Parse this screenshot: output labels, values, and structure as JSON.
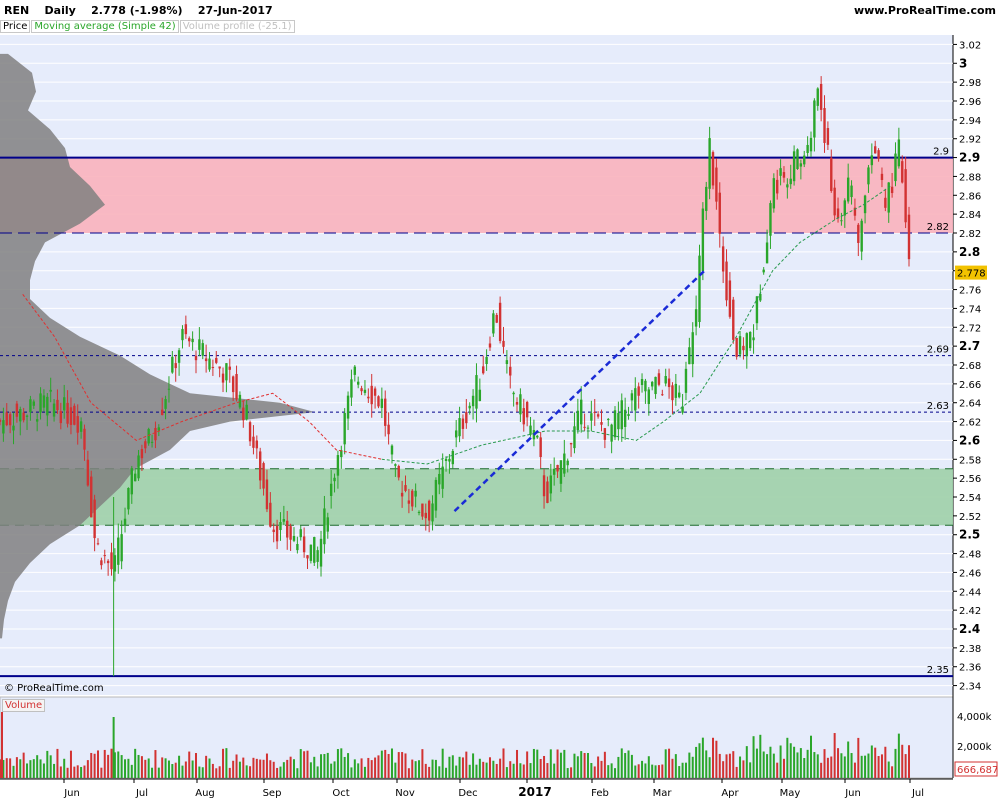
{
  "header": {
    "symbol": "REN",
    "period": "Daily",
    "price_change": "2.778 (-1.98%)",
    "date": "27-Jun-2017",
    "site": "www.ProRealTime.com"
  },
  "legend": {
    "price": "Price",
    "ma": "Moving average (Simple 42)",
    "vol_profile": "Volume profile (-25.1)"
  },
  "copyright": "© ProRealTime.com",
  "volume_label": "Volume",
  "colors": {
    "up": "#2aa62a",
    "down": "#d23232",
    "resistance_zone": "#f9b3bd",
    "support_zone": "#9fd0a8",
    "level_line": "#00008b",
    "trend_line": "#1a2bd6",
    "profile": "#808080",
    "ma_pre": "#e03030",
    "ma_post": "#2a9a50",
    "background": "#e6ecfb",
    "last_price_badge": "#f2c200"
  },
  "chart_data": {
    "type": "line",
    "price_axis": {
      "min": 2.33,
      "max": 3.03,
      "ticks": [
        "3.02",
        "3",
        "2.98",
        "2.96",
        "2.94",
        "2.92",
        "2.9",
        "2.88",
        "2.86",
        "2.84",
        "2.82",
        "2.8",
        "2.78",
        "2.76",
        "2.74",
        "2.72",
        "2.7",
        "2.68",
        "2.66",
        "2.64",
        "2.62",
        "2.6",
        "2.58",
        "2.56",
        "2.54",
        "2.52",
        "2.5",
        "2.48",
        "2.46",
        "2.44",
        "2.42",
        "2.4",
        "2.38",
        "2.36",
        "2.34"
      ]
    },
    "time_axis": {
      "labels": [
        "Jun",
        "Jul",
        "Aug",
        "Sep",
        "Oct",
        "Nov",
        "Dec",
        "2017",
        "Feb",
        "Mar",
        "Apr",
        "May",
        "Jun",
        "Jul"
      ]
    },
    "last_price": "2.778",
    "levels": [
      {
        "value": 2.9,
        "label": "2.9",
        "style": "solid"
      },
      {
        "value": 2.82,
        "label": "2.82",
        "style": "dashed"
      },
      {
        "value": 2.69,
        "label": "2.69",
        "style": "dotted"
      },
      {
        "value": 2.63,
        "label": "2.63",
        "style": "dotted"
      },
      {
        "value": 2.35,
        "label": "2.35",
        "style": "solid"
      }
    ],
    "zones": [
      {
        "from": 2.82,
        "to": 2.9,
        "kind": "resistance"
      },
      {
        "from": 2.51,
        "to": 2.57,
        "kind": "support"
      }
    ],
    "trendline": {
      "from": [
        0.5,
        2.525
      ],
      "to": [
        0.775,
        2.78
      ]
    },
    "price_path": [
      [
        0.0,
        2.62
      ],
      [
        0.055,
        2.64
      ],
      [
        0.09,
        2.62
      ],
      [
        0.105,
        2.49
      ],
      [
        0.125,
        2.46
      ],
      [
        0.15,
        2.58
      ],
      [
        0.17,
        2.61
      ],
      [
        0.2,
        2.71
      ],
      [
        0.25,
        2.67
      ],
      [
        0.27,
        2.63
      ],
      [
        0.3,
        2.51
      ],
      [
        0.35,
        2.48
      ],
      [
        0.37,
        2.58
      ],
      [
        0.39,
        2.67
      ],
      [
        0.42,
        2.64
      ],
      [
        0.435,
        2.56
      ],
      [
        0.47,
        2.52
      ],
      [
        0.5,
        2.6
      ],
      [
        0.53,
        2.67
      ],
      [
        0.545,
        2.74
      ],
      [
        0.56,
        2.66
      ],
      [
        0.59,
        2.6
      ],
      [
        0.6,
        2.54
      ],
      [
        0.62,
        2.58
      ],
      [
        0.64,
        2.63
      ],
      [
        0.67,
        2.61
      ],
      [
        0.7,
        2.65
      ],
      [
        0.73,
        2.66
      ],
      [
        0.75,
        2.64
      ],
      [
        0.765,
        2.73
      ],
      [
        0.78,
        2.92
      ],
      [
        0.795,
        2.79
      ],
      [
        0.81,
        2.69
      ],
      [
        0.83,
        2.72
      ],
      [
        0.85,
        2.87
      ],
      [
        0.87,
        2.89
      ],
      [
        0.89,
        2.91
      ],
      [
        0.9,
        2.98
      ],
      [
        0.92,
        2.83
      ],
      [
        0.935,
        2.87
      ],
      [
        0.945,
        2.81
      ],
      [
        0.96,
        2.92
      ],
      [
        0.975,
        2.85
      ],
      [
        0.99,
        2.91
      ],
      [
        1.0,
        2.78
      ]
    ],
    "ma_path": [
      [
        0.025,
        2.755
      ],
      [
        0.06,
        2.71
      ],
      [
        0.1,
        2.64
      ],
      [
        0.15,
        2.6
      ],
      [
        0.2,
        2.62
      ],
      [
        0.26,
        2.64
      ],
      [
        0.3,
        2.65
      ],
      [
        0.34,
        2.62
      ],
      [
        0.37,
        2.59
      ],
      [
        0.42,
        2.58
      ],
      [
        0.47,
        2.575
      ],
      [
        0.53,
        2.595
      ],
      [
        0.6,
        2.61
      ],
      [
        0.65,
        2.61
      ],
      [
        0.7,
        2.6
      ],
      [
        0.73,
        2.62
      ],
      [
        0.77,
        2.65
      ],
      [
        0.81,
        2.71
      ],
      [
        0.85,
        2.78
      ],
      [
        0.88,
        2.81
      ],
      [
        0.92,
        2.835
      ],
      [
        0.95,
        2.85
      ],
      [
        0.98,
        2.87
      ]
    ],
    "volume_axis": {
      "ticks": [
        "4,000k",
        "2,000k"
      ],
      "last": "666,687"
    }
  }
}
